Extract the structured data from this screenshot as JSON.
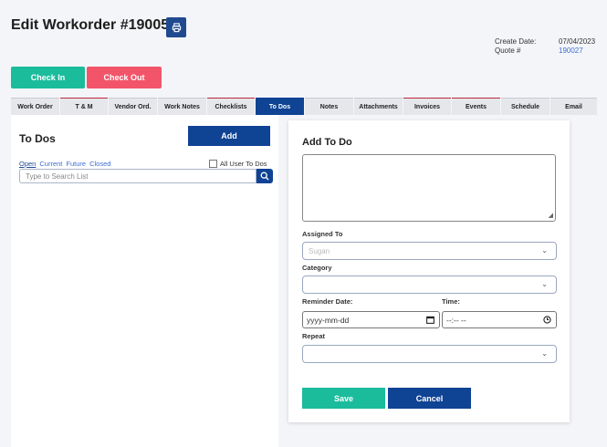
{
  "header": {
    "title": "Edit Workorder #190058",
    "print_icon": "printer-icon",
    "create_date_label": "Create Date:",
    "create_date_value": "07/04/2023",
    "quote_label": "Quote #",
    "quote_value": "190027"
  },
  "actions": {
    "check_in": "Check In",
    "check_out": "Check Out"
  },
  "tabs": [
    {
      "label": "Work Order"
    },
    {
      "label": "T & M"
    },
    {
      "label": "Vendor Ord."
    },
    {
      "label": "Work Notes"
    },
    {
      "label": "Checklists"
    },
    {
      "label": "To Dos"
    },
    {
      "label": "Notes"
    },
    {
      "label": "Attachments"
    },
    {
      "label": "Invoices"
    },
    {
      "label": "Events"
    },
    {
      "label": "Schedule"
    },
    {
      "label": "Email"
    }
  ],
  "todos": {
    "title": "To Dos",
    "add_label": "Add",
    "filters": [
      "Open",
      "Current",
      "Future",
      "Closed"
    ],
    "all_users_label": "All User To Dos",
    "search_placeholder": "Type to Search List"
  },
  "add_todo": {
    "title": "Add To Do",
    "assigned_label": "Assigned To",
    "assigned_value": "Sugan",
    "category_label": "Category",
    "reminder_label": "Reminder Date:",
    "reminder_placeholder": "yyyy-mm-dd",
    "time_label": "Time:",
    "time_placeholder": "--:-- --",
    "repeat_label": "Repeat",
    "save_label": "Save",
    "cancel_label": "Cancel"
  },
  "colors": {
    "accent": "#0f4394",
    "success": "#1abc9c",
    "danger": "#f2556a"
  }
}
